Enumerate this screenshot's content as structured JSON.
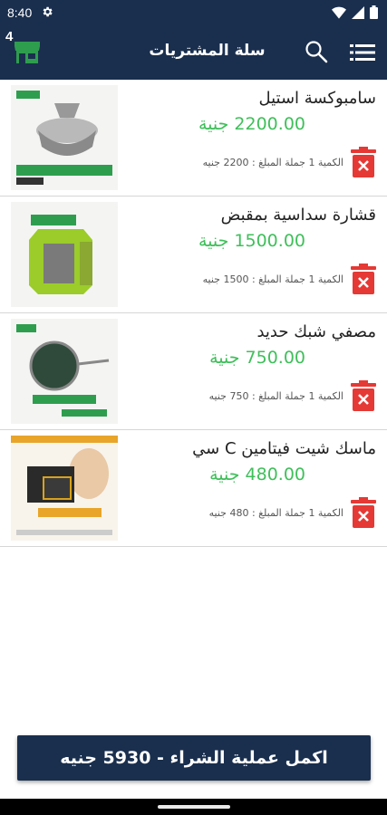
{
  "status_bar": {
    "time": "8:40"
  },
  "app_bar": {
    "cart_count": "4",
    "title": "سلة المشتريات"
  },
  "items": [
    {
      "name": "سامبوكسة استيل",
      "price": "2200.00 جنية",
      "details": "الكمية 1 جملة المبلغ : 2200 جنيه"
    },
    {
      "name": "قشارة سداسية بمقبض",
      "price": "1500.00 جنية",
      "details": "الكمية 1 جملة المبلغ : 1500 جنيه"
    },
    {
      "name": "مصفي شبك حديد",
      "price": "750.00 جنية",
      "details": "الكمية 1 جملة المبلغ : 750 جنيه"
    },
    {
      "name": "ماسك شيت فيتامين C سي",
      "price": "480.00 جنية",
      "details": "الكمية 1 جملة المبلغ : 480 جنيه"
    }
  ],
  "checkout": {
    "label": "اكمل عملية الشراء - 5930 جنيه"
  },
  "colors": {
    "primary": "#1a2f4e",
    "price": "#3fbf5a",
    "delete": "#e53935",
    "store_icon": "#2e9e4e"
  }
}
